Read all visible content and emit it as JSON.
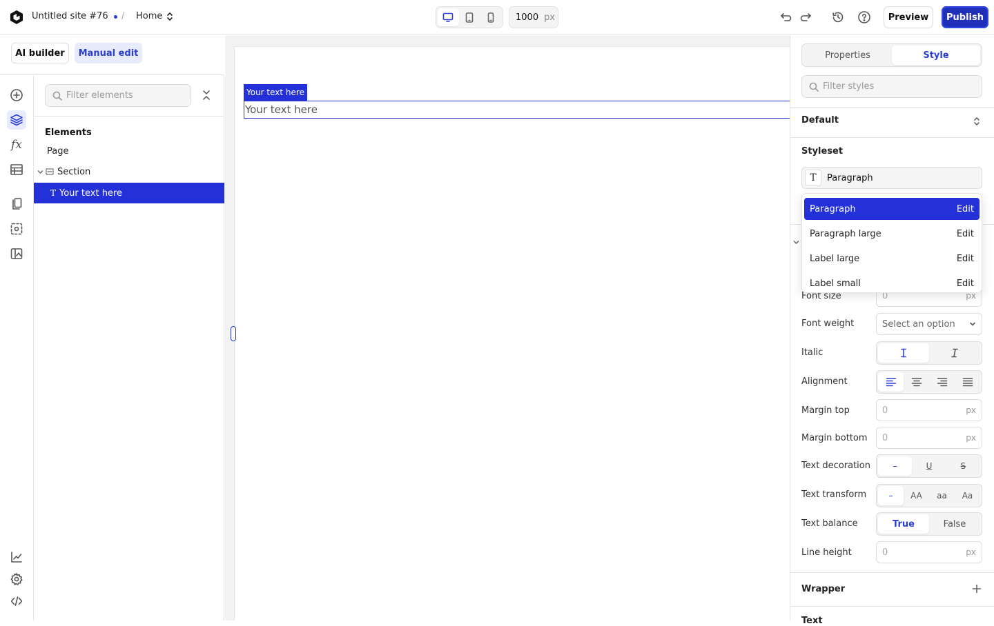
{
  "topbar": {
    "site_name": "Untitled site #76",
    "separator": "/",
    "page_name": "Home",
    "width_value": "1000",
    "width_unit": "px",
    "preview_label": "Preview",
    "publish_label": "Publish",
    "active_device": "desktop"
  },
  "mode": {
    "ai_label": "AI builder",
    "manual_label": "Manual edit"
  },
  "rail": {
    "items": [
      "add-icon",
      "layers-icon",
      "function-icon",
      "table-icon",
      "pages-icon",
      "components-icon",
      "assets-icon"
    ],
    "bottom_items": [
      "analytics-icon",
      "settings-icon",
      "code-icon"
    ]
  },
  "elements_panel": {
    "filter_placeholder": "Filter elements",
    "heading": "Elements",
    "tree": [
      {
        "label": "Page"
      },
      {
        "label": "Section"
      },
      {
        "label": "Your text here",
        "selected": true
      }
    ]
  },
  "canvas": {
    "selected_tag": "Your text here",
    "text": "Your text here"
  },
  "style_panel": {
    "tabs": [
      "Properties",
      "Style"
    ],
    "active_tab": "Style",
    "filter_placeholder": "Filter styles",
    "default_label": "Default",
    "styleset_title": "Styleset",
    "styleset_value": "Paragraph",
    "dropdown": [
      {
        "label": "Paragraph",
        "edit": "Edit",
        "active": true
      },
      {
        "label": "Paragraph large",
        "edit": "Edit"
      },
      {
        "label": "Label large",
        "edit": "Edit"
      },
      {
        "label": "Label small",
        "edit": "Edit"
      }
    ],
    "props": {
      "font_size": {
        "label": "Font size",
        "value": "0",
        "unit": "px"
      },
      "font_weight": {
        "label": "Font weight",
        "value": "Select an option"
      },
      "italic": {
        "label": "Italic"
      },
      "alignment": {
        "label": "Alignment"
      },
      "margin_top": {
        "label": "Margin top",
        "value": "0",
        "unit": "px"
      },
      "margin_bottom": {
        "label": "Margin bottom",
        "value": "0",
        "unit": "px"
      },
      "text_decoration": {
        "label": "Text decoration",
        "options": [
          "–",
          "U",
          "S"
        ]
      },
      "text_transform": {
        "label": "Text transform",
        "options": [
          "–",
          "AA",
          "aa",
          "Aa"
        ]
      },
      "text_balance": {
        "label": "Text balance",
        "options": [
          "True",
          "False"
        ]
      },
      "line_height": {
        "label": "Line height",
        "value": "0",
        "unit": "px"
      }
    },
    "wrapper_title": "Wrapper",
    "next_title": "Text"
  },
  "colors": {
    "accent": "#2431d8",
    "accent_light": "#e8ebfb"
  }
}
